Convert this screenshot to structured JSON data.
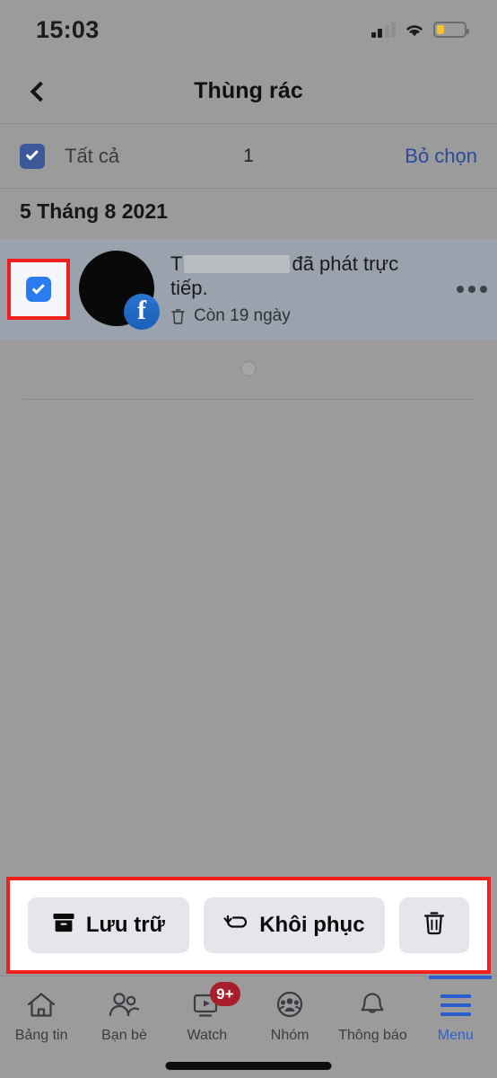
{
  "status_bar": {
    "time": "15:03",
    "signal_icon": "cellular-signal-icon",
    "signal_bars_filled": 2,
    "wifi_icon": "wifi-icon",
    "battery_icon": "battery-low-icon",
    "battery_level_percent": 28,
    "battery_color": "#f2c230"
  },
  "header": {
    "back_icon": "back-chevron-icon",
    "title": "Thùng rác"
  },
  "select_bar": {
    "checkbox_icon": "checkbox-checked-icon",
    "checked": true,
    "all_label": "Tất cả",
    "count": "1",
    "deselect_label": "Bỏ chọn",
    "deselect_color": "#2b4a9b"
  },
  "date_header": "5 Tháng 8 2021",
  "list_item": {
    "checkbox_icon": "checkbox-checked-icon",
    "checked": true,
    "highlight_color": "#f21f1f",
    "avatar_icon": "avatar-image",
    "source_badge_icon": "facebook-badge-icon",
    "source_badge_glyph": "f",
    "title_prefix": "T",
    "title_redacted": true,
    "title_suffix": "đã phát trực tiếp.",
    "meta_icon": "trash-icon",
    "meta_text": "Còn 19 ngày",
    "more_icon": "more-options-icon",
    "row_background": "#9aa2ad"
  },
  "loading_spinner_icon": "loading-spinner-icon",
  "action_bar": {
    "highlight_color": "#f21f1f",
    "archive": {
      "icon": "archive-box-icon",
      "label": "Lưu trữ"
    },
    "restore": {
      "icon": "undo-arrow-icon",
      "label": "Khôi phục"
    },
    "delete": {
      "icon": "trash-icon",
      "label": ""
    }
  },
  "bottom_nav": {
    "active_index": 5,
    "accent_color": "#2b5fd0",
    "items": [
      {
        "icon": "home-icon",
        "label": "Bảng tin",
        "badge": ""
      },
      {
        "icon": "friends-icon",
        "label": "Bạn bè",
        "badge": ""
      },
      {
        "icon": "watch-video-icon",
        "label": "Watch",
        "badge": "9+"
      },
      {
        "icon": "groups-icon",
        "label": "Nhóm",
        "badge": ""
      },
      {
        "icon": "bell-icon",
        "label": "Thông báo",
        "badge": ""
      },
      {
        "icon": "hamburger-menu-icon",
        "label": "Menu",
        "badge": ""
      }
    ]
  }
}
